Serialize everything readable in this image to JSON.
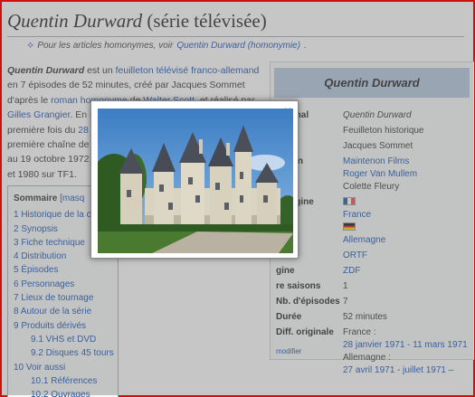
{
  "page": {
    "title_italic": "Quentin Durward",
    "title_rest": " (série télévisée)",
    "hatnote": {
      "prefix": "Pour les articles homonymes, voir ",
      "link": "Quentin Durward (homonymie)",
      "suffix": "."
    }
  },
  "intro": {
    "bold": "Quentin Durward",
    "t1": " est un ",
    "l1": "feuilleton télévisé franco-allemand",
    "t2": " en 7 épisodes de 52 minutes, créé par Jacques Sommet d'après le ",
    "l2": "roman homonyme",
    "t3": " de ",
    "l3": "Walter Scott",
    "t4": ", et réalisé par ",
    "l4": "Gilles Grangier",
    "t5": ". En F",
    "t6": "première fois du ",
    "l5": "28",
    "t7": "première chaîne de ",
    "t8": "au 19 octobre 1972",
    "t9": "et 1980 sur TF1."
  },
  "toc": {
    "title": "Sommaire",
    "toggle": "[masq",
    "items": [
      {
        "label": "1 Historique de la cr",
        "level": 1
      },
      {
        "label": "2 Synopsis",
        "level": 1
      },
      {
        "label": "3 Fiche technique",
        "level": 1
      },
      {
        "label": "4 Distribution",
        "level": 1
      },
      {
        "label": "5 Épisodes",
        "level": 1
      },
      {
        "label": "6 Personnages",
        "level": 1
      },
      {
        "label": "7 Lieux de tournage",
        "level": 1
      },
      {
        "label": "8 Autour de la série",
        "level": 1
      },
      {
        "label": "9 Produits dérivés",
        "level": 1
      },
      {
        "label": "9.1 VHS et DVD",
        "level": 2
      },
      {
        "label": "9.2 Disques 45 tours",
        "level": 2
      },
      {
        "label": "10 Voir aussi",
        "level": 1
      },
      {
        "label": "10.1 Références",
        "level": 2
      },
      {
        "label": "10.2 Ouvrages",
        "level": 2
      }
    ]
  },
  "infobox": {
    "title": "Quentin Durward",
    "rows": [
      {
        "label": "original",
        "values": [
          "Quentin Durward"
        ],
        "italic": true
      },
      {
        "label": "e",
        "values": [
          "Feuilleton historique"
        ]
      },
      {
        "label": "tion",
        "values": [
          "Jacques Sommet"
        ]
      },
      {
        "label": "uction",
        "links": [
          "Maintenon Films",
          "Roger Van Mullem"
        ],
        "values": [
          "Colette Fleury"
        ]
      },
      {
        "label": "d'origine",
        "flags": [
          {
            "flag": "fr",
            "name": "France"
          },
          {
            "flag": "de",
            "name": "Allemagne"
          }
        ]
      },
      {
        "label": "ne",
        "links": [
          "ORTF"
        ]
      },
      {
        "label": "gine",
        "links": [
          "ZDF"
        ]
      },
      {
        "label": "re saisons",
        "values": [
          "1"
        ]
      },
      {
        "label": "Nb. d'épisodes",
        "values": [
          "7"
        ]
      },
      {
        "label": "Durée",
        "values": [
          "52 minutes"
        ]
      },
      {
        "label": "Diff. originale",
        "mixed": [
          {
            "text": "France :"
          },
          {
            "link": "28 janvier 1971 - 11 mars 1971"
          },
          {
            "text": "Allemagne :"
          },
          {
            "link": "27 avril 1971 - juillet 1971 –"
          }
        ]
      }
    ],
    "footer": "modifier"
  },
  "lightbox": {
    "close_symbol": "×",
    "photo_icon": "castle-photo",
    "colors": {
      "sky": "#4a86c8",
      "stone": "#d8d2c0",
      "roof": "#4a4f5a",
      "grass": "#3f6a2a"
    }
  }
}
